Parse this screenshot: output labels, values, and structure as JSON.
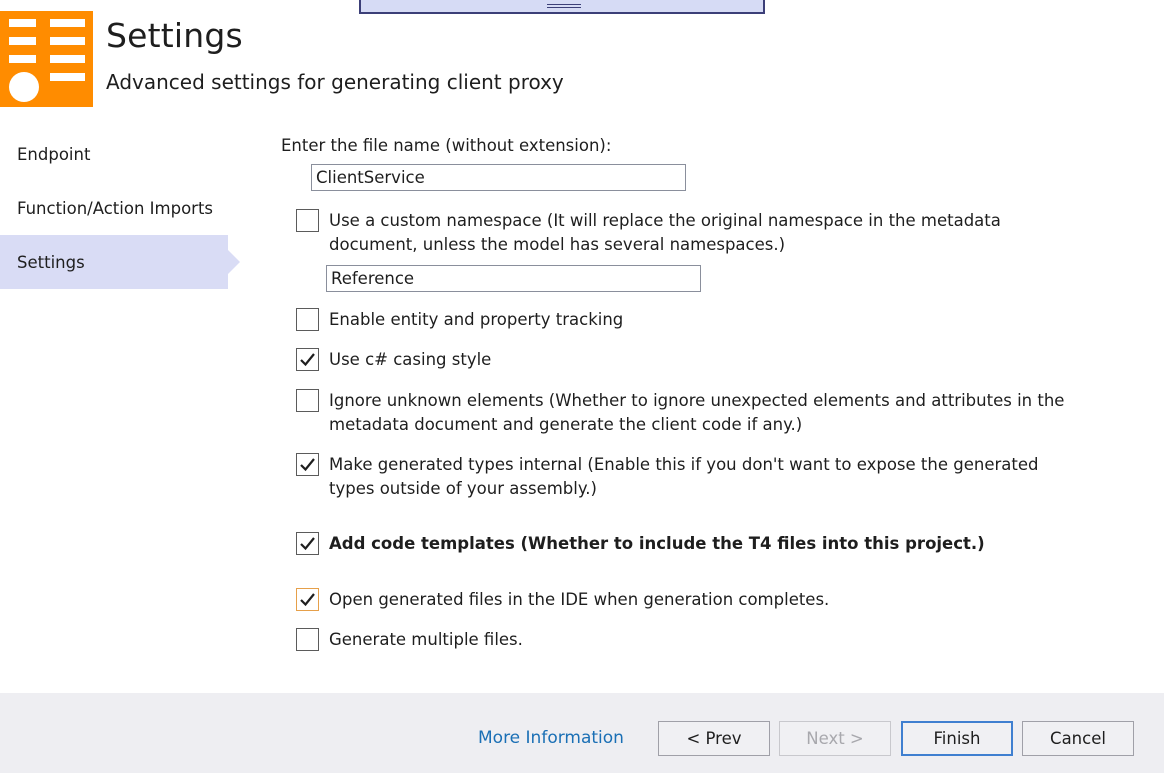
{
  "header": {
    "title": "Settings",
    "subtitle": "Advanced settings for generating client proxy",
    "logo_icon": "settings-list-icon",
    "logo_color": "#ff8c00"
  },
  "nav": {
    "items": [
      {
        "label": "Endpoint",
        "active": false
      },
      {
        "label": "Function/Action Imports",
        "active": false
      },
      {
        "label": "Settings",
        "active": true
      }
    ]
  },
  "form": {
    "file_name_label": "Enter the file name (without extension):",
    "file_name_value": "ClientService",
    "custom_namespace": {
      "label": "Use a custom namespace (It will replace the original namespace in the metadata document, unless the model has several namespaces.)",
      "checked": false,
      "value": "Reference"
    },
    "options": [
      {
        "label": "Enable entity and property tracking",
        "checked": false
      },
      {
        "label": "Use c# casing style",
        "checked": true
      },
      {
        "label": "Ignore unknown elements (Whether to ignore unexpected elements and attributes in the metadata document and generate the client code if any.)",
        "checked": false
      },
      {
        "label": "Make generated types internal (Enable this if you don't want to expose the generated types outside of your assembly.)",
        "checked": true
      },
      {
        "label": "Add code templates (Whether to include the T4 files into this project.)",
        "checked": true
      },
      {
        "label": "Open generated files in the IDE when generation completes.",
        "checked": true
      },
      {
        "label": "Generate multiple files.",
        "checked": false
      }
    ]
  },
  "footer": {
    "more_info": "More Information",
    "prev": "< Prev",
    "next": "Next >",
    "finish": "Finish",
    "cancel": "Cancel",
    "link_color": "#1a6fb5"
  }
}
